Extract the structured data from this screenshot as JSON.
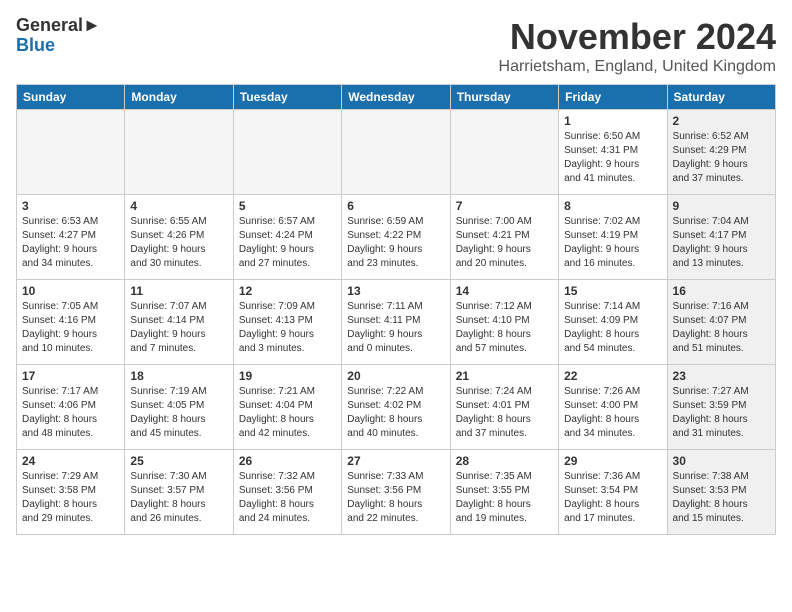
{
  "logo": {
    "line1": "General",
    "line2": "Blue"
  },
  "title": "November 2024",
  "location": "Harrietsham, England, United Kingdom",
  "days_of_week": [
    "Sunday",
    "Monday",
    "Tuesday",
    "Wednesday",
    "Thursday",
    "Friday",
    "Saturday"
  ],
  "weeks": [
    [
      {
        "day": "",
        "info": "",
        "empty": true
      },
      {
        "day": "",
        "info": "",
        "empty": true
      },
      {
        "day": "",
        "info": "",
        "empty": true
      },
      {
        "day": "",
        "info": "",
        "empty": true
      },
      {
        "day": "",
        "info": "",
        "empty": true
      },
      {
        "day": "1",
        "info": "Sunrise: 6:50 AM\nSunset: 4:31 PM\nDaylight: 9 hours\nand 41 minutes.",
        "empty": false,
        "shaded": false
      },
      {
        "day": "2",
        "info": "Sunrise: 6:52 AM\nSunset: 4:29 PM\nDaylight: 9 hours\nand 37 minutes.",
        "empty": false,
        "shaded": true
      }
    ],
    [
      {
        "day": "3",
        "info": "Sunrise: 6:53 AM\nSunset: 4:27 PM\nDaylight: 9 hours\nand 34 minutes.",
        "empty": false,
        "shaded": false
      },
      {
        "day": "4",
        "info": "Sunrise: 6:55 AM\nSunset: 4:26 PM\nDaylight: 9 hours\nand 30 minutes.",
        "empty": false,
        "shaded": false
      },
      {
        "day": "5",
        "info": "Sunrise: 6:57 AM\nSunset: 4:24 PM\nDaylight: 9 hours\nand 27 minutes.",
        "empty": false,
        "shaded": false
      },
      {
        "day": "6",
        "info": "Sunrise: 6:59 AM\nSunset: 4:22 PM\nDaylight: 9 hours\nand 23 minutes.",
        "empty": false,
        "shaded": false
      },
      {
        "day": "7",
        "info": "Sunrise: 7:00 AM\nSunset: 4:21 PM\nDaylight: 9 hours\nand 20 minutes.",
        "empty": false,
        "shaded": false
      },
      {
        "day": "8",
        "info": "Sunrise: 7:02 AM\nSunset: 4:19 PM\nDaylight: 9 hours\nand 16 minutes.",
        "empty": false,
        "shaded": false
      },
      {
        "day": "9",
        "info": "Sunrise: 7:04 AM\nSunset: 4:17 PM\nDaylight: 9 hours\nand 13 minutes.",
        "empty": false,
        "shaded": true
      }
    ],
    [
      {
        "day": "10",
        "info": "Sunrise: 7:05 AM\nSunset: 4:16 PM\nDaylight: 9 hours\nand 10 minutes.",
        "empty": false,
        "shaded": false
      },
      {
        "day": "11",
        "info": "Sunrise: 7:07 AM\nSunset: 4:14 PM\nDaylight: 9 hours\nand 7 minutes.",
        "empty": false,
        "shaded": false
      },
      {
        "day": "12",
        "info": "Sunrise: 7:09 AM\nSunset: 4:13 PM\nDaylight: 9 hours\nand 3 minutes.",
        "empty": false,
        "shaded": false
      },
      {
        "day": "13",
        "info": "Sunrise: 7:11 AM\nSunset: 4:11 PM\nDaylight: 9 hours\nand 0 minutes.",
        "empty": false,
        "shaded": false
      },
      {
        "day": "14",
        "info": "Sunrise: 7:12 AM\nSunset: 4:10 PM\nDaylight: 8 hours\nand 57 minutes.",
        "empty": false,
        "shaded": false
      },
      {
        "day": "15",
        "info": "Sunrise: 7:14 AM\nSunset: 4:09 PM\nDaylight: 8 hours\nand 54 minutes.",
        "empty": false,
        "shaded": false
      },
      {
        "day": "16",
        "info": "Sunrise: 7:16 AM\nSunset: 4:07 PM\nDaylight: 8 hours\nand 51 minutes.",
        "empty": false,
        "shaded": true
      }
    ],
    [
      {
        "day": "17",
        "info": "Sunrise: 7:17 AM\nSunset: 4:06 PM\nDaylight: 8 hours\nand 48 minutes.",
        "empty": false,
        "shaded": false
      },
      {
        "day": "18",
        "info": "Sunrise: 7:19 AM\nSunset: 4:05 PM\nDaylight: 8 hours\nand 45 minutes.",
        "empty": false,
        "shaded": false
      },
      {
        "day": "19",
        "info": "Sunrise: 7:21 AM\nSunset: 4:04 PM\nDaylight: 8 hours\nand 42 minutes.",
        "empty": false,
        "shaded": false
      },
      {
        "day": "20",
        "info": "Sunrise: 7:22 AM\nSunset: 4:02 PM\nDaylight: 8 hours\nand 40 minutes.",
        "empty": false,
        "shaded": false
      },
      {
        "day": "21",
        "info": "Sunrise: 7:24 AM\nSunset: 4:01 PM\nDaylight: 8 hours\nand 37 minutes.",
        "empty": false,
        "shaded": false
      },
      {
        "day": "22",
        "info": "Sunrise: 7:26 AM\nSunset: 4:00 PM\nDaylight: 8 hours\nand 34 minutes.",
        "empty": false,
        "shaded": false
      },
      {
        "day": "23",
        "info": "Sunrise: 7:27 AM\nSunset: 3:59 PM\nDaylight: 8 hours\nand 31 minutes.",
        "empty": false,
        "shaded": true
      }
    ],
    [
      {
        "day": "24",
        "info": "Sunrise: 7:29 AM\nSunset: 3:58 PM\nDaylight: 8 hours\nand 29 minutes.",
        "empty": false,
        "shaded": false
      },
      {
        "day": "25",
        "info": "Sunrise: 7:30 AM\nSunset: 3:57 PM\nDaylight: 8 hours\nand 26 minutes.",
        "empty": false,
        "shaded": false
      },
      {
        "day": "26",
        "info": "Sunrise: 7:32 AM\nSunset: 3:56 PM\nDaylight: 8 hours\nand 24 minutes.",
        "empty": false,
        "shaded": false
      },
      {
        "day": "27",
        "info": "Sunrise: 7:33 AM\nSunset: 3:56 PM\nDaylight: 8 hours\nand 22 minutes.",
        "empty": false,
        "shaded": false
      },
      {
        "day": "28",
        "info": "Sunrise: 7:35 AM\nSunset: 3:55 PM\nDaylight: 8 hours\nand 19 minutes.",
        "empty": false,
        "shaded": false
      },
      {
        "day": "29",
        "info": "Sunrise: 7:36 AM\nSunset: 3:54 PM\nDaylight: 8 hours\nand 17 minutes.",
        "empty": false,
        "shaded": false
      },
      {
        "day": "30",
        "info": "Sunrise: 7:38 AM\nSunset: 3:53 PM\nDaylight: 8 hours\nand 15 minutes.",
        "empty": false,
        "shaded": true
      }
    ]
  ]
}
